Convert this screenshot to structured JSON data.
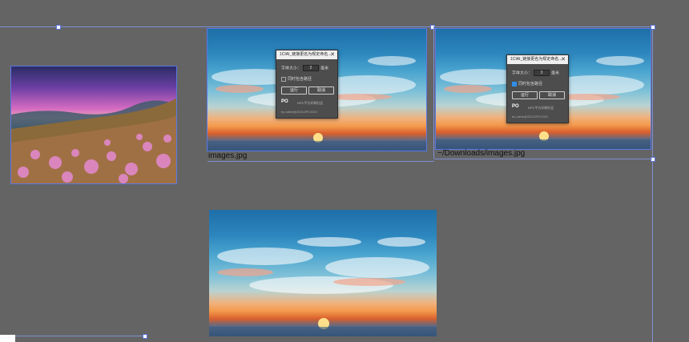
{
  "canvas": {
    "background": "#646464",
    "selection_color": "#5b78e6"
  },
  "images": [
    {
      "name": "mountain-photo"
    },
    {
      "name": "sky-photo-1",
      "caption": "images.jpg"
    },
    {
      "name": "sky-photo-2",
      "caption": "~/Downloads/images.jpg"
    },
    {
      "name": "sky-photo-3"
    }
  ],
  "dialog1": {
    "title": "1CIAI_链接更名为规定命名...",
    "close": "✕",
    "size_label": "字体大小：",
    "size_value": "2",
    "size_unit": "毫米",
    "checkbox_label": "同时包含路径",
    "checkbox_checked": false,
    "run_label": "运行",
    "cancel_label": "取消",
    "brand": "PO",
    "brand_sub": "DPC平方印刷社区",
    "by": "by caihe@2021DPC2021"
  },
  "dialog2": {
    "title": "1CIAI_链接更名为规定命名...",
    "close": "✕",
    "size_label": "字体大小：",
    "size_value": "3",
    "size_unit": "毫米",
    "checkbox_label": "同时包含路径",
    "checkbox_checked": true,
    "run_label": "运行",
    "cancel_label": "取消",
    "brand": "PO",
    "brand_sub": "DPC平方印刷社区",
    "by": "by caihe@2021DPC2021"
  }
}
